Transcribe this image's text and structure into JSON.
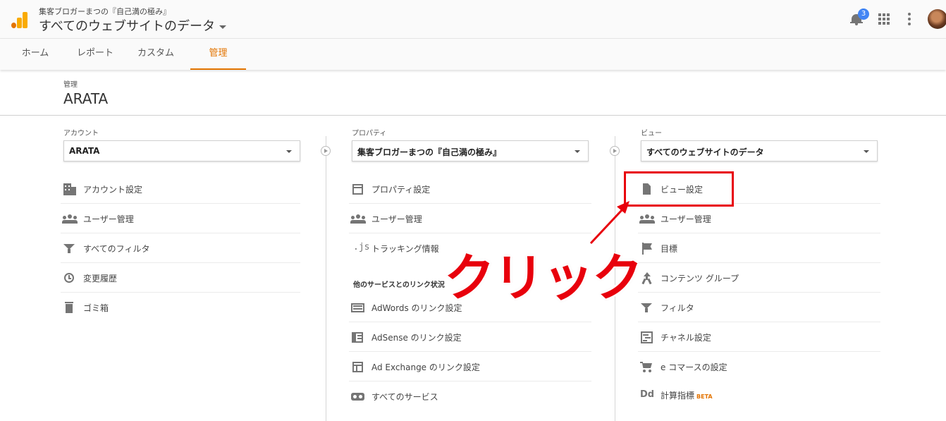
{
  "topbar": {
    "account_subtitle": "集客ブロガーまつの『自己満の極み』",
    "view_title": "すべてのウェブサイトのデータ",
    "notification_count": "3"
  },
  "tabs": [
    "ホーム",
    "レポート",
    "カスタム",
    "管理"
  ],
  "active_tab": "管理",
  "page": {
    "label": "管理",
    "title": "ARATA"
  },
  "account_col": {
    "label": "アカウント",
    "selected": "ARATA",
    "items": [
      "アカウント設定",
      "ユーザー管理",
      "すべてのフィルタ",
      "変更履歴",
      "ゴミ箱"
    ]
  },
  "property_col": {
    "label": "プロパティ",
    "selected": "集客ブロガーまつの『自己満の極み』",
    "items": [
      "プロパティ設定",
      "ユーザー管理",
      "トラッキング情報"
    ],
    "section_title": "他のサービスとのリンク状況",
    "link_items": [
      "AdWords のリンク設定",
      "AdSense のリンク設定",
      "Ad Exchange のリンク設定",
      "すべてのサービス"
    ]
  },
  "view_col": {
    "label": "ビュー",
    "selected": "すべてのウェブサイトのデータ",
    "items": [
      "ビュー設定",
      "ユーザー管理",
      "目標",
      "コンテンツ グループ",
      "フィルタ",
      "チャネル設定",
      "e コマースの設定",
      "計算指標"
    ],
    "beta_label": "BETA"
  },
  "annotation": {
    "text": "クリック",
    "color": "#e8000c"
  },
  "colors": {
    "accent": "#e37400",
    "badge": "#4285f4"
  }
}
